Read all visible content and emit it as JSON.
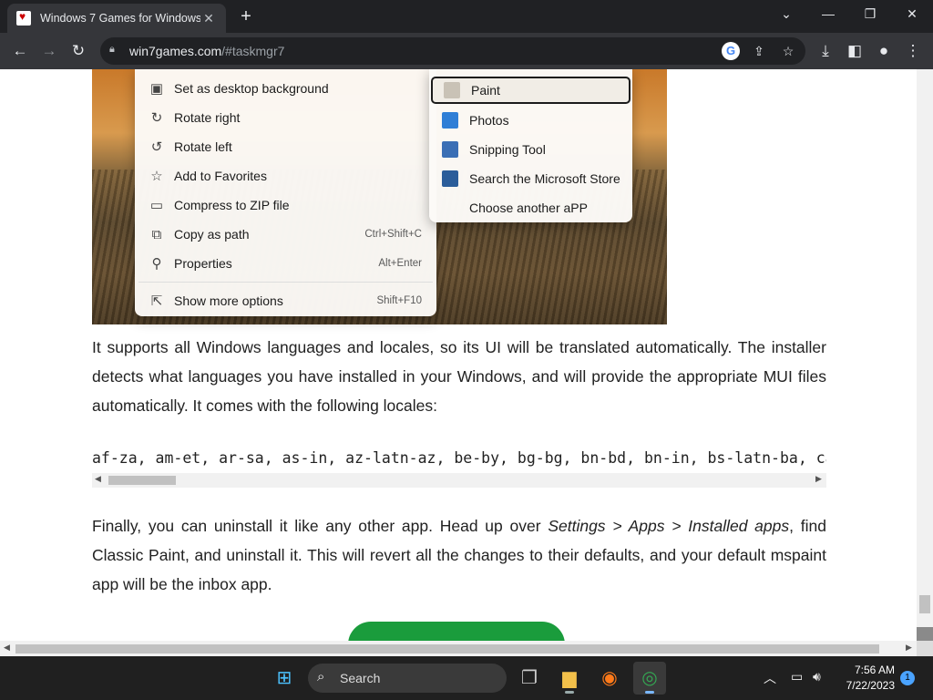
{
  "browser": {
    "tab_title": "Windows 7 Games for Windows",
    "url_host": "win7games.com",
    "url_path": "/#taskmgr7"
  },
  "context_menu": {
    "items": [
      {
        "label": "Set as desktop background",
        "icon": "wallpaper-icon",
        "shortcut": ""
      },
      {
        "label": "Rotate right",
        "icon": "rotate-right-icon",
        "shortcut": ""
      },
      {
        "label": "Rotate left",
        "icon": "rotate-left-icon",
        "shortcut": ""
      },
      {
        "label": "Add to Favorites",
        "icon": "star-icon",
        "shortcut": ""
      },
      {
        "label": "Compress to ZIP file",
        "icon": "zip-icon",
        "shortcut": ""
      },
      {
        "label": "Copy as path",
        "icon": "copy-path-icon",
        "shortcut": "Ctrl+Shift+C"
      },
      {
        "label": "Properties",
        "icon": "wrench-icon",
        "shortcut": "Alt+Enter"
      },
      {
        "label": "Show more options",
        "icon": "more-options-icon",
        "shortcut": "Shift+F10"
      }
    ]
  },
  "open_with_menu": {
    "items": [
      {
        "label": "Paint",
        "icon": "paint-icon",
        "color": "#c9c2b6"
      },
      {
        "label": "Photos",
        "icon": "photos-icon",
        "color": "#2f7fd6"
      },
      {
        "label": "Snipping Tool",
        "icon": "snipping-tool-icon",
        "color": "#3a6fb5"
      },
      {
        "label": "Search the Microsoft Store",
        "icon": "store-icon",
        "color": "#2b5d9a"
      },
      {
        "label": "Choose another aPP",
        "icon": "",
        "color": ""
      }
    ]
  },
  "article": {
    "para1": "It supports all Windows languages and locales, so its UI will be translated automatically. The installer detects what languages you have installed in your Windows, and will provide the appropriate MUI files automatically. It comes with the following locales:",
    "locales": "af-za, am-et, ar-sa, as-in, az-latn-az, be-by, bg-bg, bn-bd, bn-in, bs-latn-ba, ca-es",
    "para2_a": "Finally, you can uninstall it like any other app. Head up over ",
    "para2_em": "Settings > Apps > Installed apps",
    "para2_b": ", find Classic Paint, and uninstall it. This will revert all the changes to their defaults, and your default mspaint app will be the inbox app."
  },
  "taskbar": {
    "search_label": "Search",
    "time": "7:56 AM",
    "date": "7/22/2023",
    "notification_count": "1"
  }
}
